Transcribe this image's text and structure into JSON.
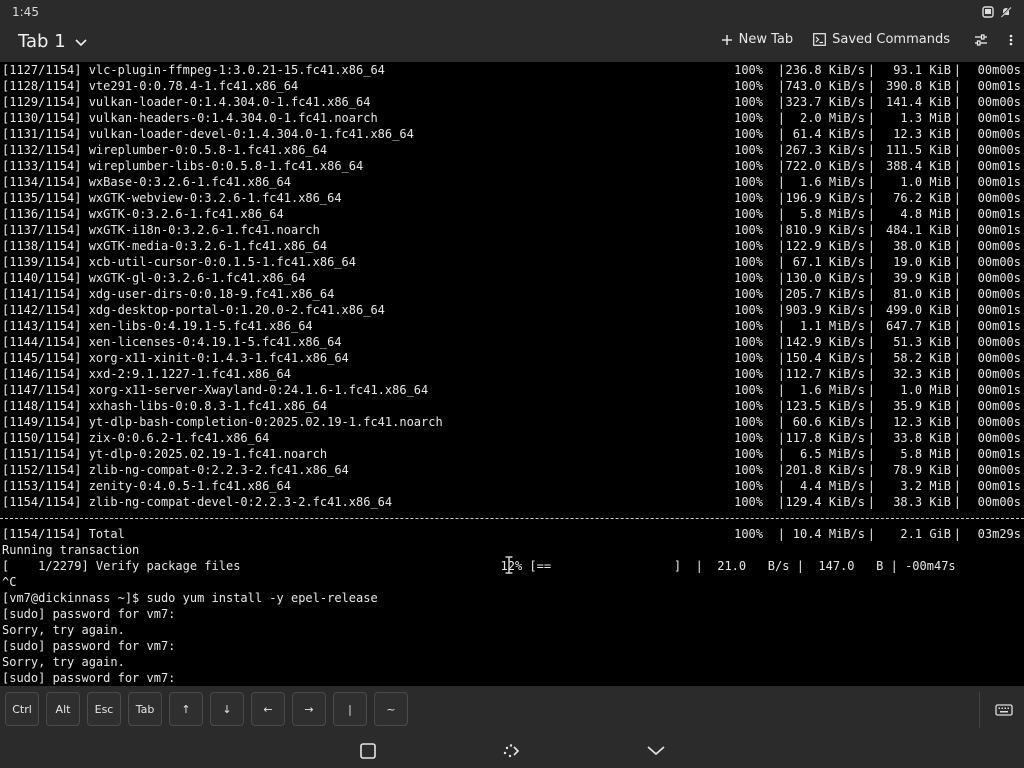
{
  "status_bar": {
    "time": "1:45"
  },
  "app_bar": {
    "tab_title": "Tab 1",
    "new_tab_label": "New Tab",
    "saved_commands_label": "Saved Commands"
  },
  "terminal": {
    "package_lines": [
      {
        "label": "[1127/1154] vlc-plugin-ffmpeg-1:3.0.21-15.fc41.x86_64",
        "pct": "100%",
        "speed": "236.8 KiB/s",
        "size": "93.1 KiB",
        "time": "00m00s"
      },
      {
        "label": "[1128/1154] vte291-0:0.78.4-1.fc41.x86_64",
        "pct": "100%",
        "speed": "743.0 KiB/s",
        "size": "390.8 KiB",
        "time": "00m01s"
      },
      {
        "label": "[1129/1154] vulkan-loader-0:1.4.304.0-1.fc41.x86_64",
        "pct": "100%",
        "speed": "323.7 KiB/s",
        "size": "141.4 KiB",
        "time": "00m00s"
      },
      {
        "label": "[1130/1154] vulkan-headers-0:1.4.304.0-1.fc41.noarch",
        "pct": "100%",
        "speed": "2.0 MiB/s",
        "size": "1.3 MiB",
        "time": "00m01s"
      },
      {
        "label": "[1131/1154] vulkan-loader-devel-0:1.4.304.0-1.fc41.x86_64",
        "pct": "100%",
        "speed": "61.4 KiB/s",
        "size": "12.3 KiB",
        "time": "00m00s"
      },
      {
        "label": "[1132/1154] wireplumber-0:0.5.8-1.fc41.x86_64",
        "pct": "100%",
        "speed": "267.3 KiB/s",
        "size": "111.5 KiB",
        "time": "00m00s"
      },
      {
        "label": "[1133/1154] wireplumber-libs-0:0.5.8-1.fc41.x86_64",
        "pct": "100%",
        "speed": "722.0 KiB/s",
        "size": "388.4 KiB",
        "time": "00m01s"
      },
      {
        "label": "[1134/1154] wxBase-0:3.2.6-1.fc41.x86_64",
        "pct": "100%",
        "speed": "1.6 MiB/s",
        "size": "1.0 MiB",
        "time": "00m01s"
      },
      {
        "label": "[1135/1154] wxGTK-webview-0:3.2.6-1.fc41.x86_64",
        "pct": "100%",
        "speed": "196.9 KiB/s",
        "size": "76.2 KiB",
        "time": "00m00s"
      },
      {
        "label": "[1136/1154] wxGTK-0:3.2.6-1.fc41.x86_64",
        "pct": "100%",
        "speed": "5.8 MiB/s",
        "size": "4.8 MiB",
        "time": "00m01s"
      },
      {
        "label": "[1137/1154] wxGTK-i18n-0:3.2.6-1.fc41.noarch",
        "pct": "100%",
        "speed": "810.9 KiB/s",
        "size": "484.1 KiB",
        "time": "00m01s"
      },
      {
        "label": "[1138/1154] wxGTK-media-0:3.2.6-1.fc41.x86_64",
        "pct": "100%",
        "speed": "122.9 KiB/s",
        "size": "38.0 KiB",
        "time": "00m00s"
      },
      {
        "label": "[1139/1154] xcb-util-cursor-0:0.1.5-1.fc41.x86_64",
        "pct": "100%",
        "speed": "67.1 KiB/s",
        "size": "19.0 KiB",
        "time": "00m00s"
      },
      {
        "label": "[1140/1154] wxGTK-gl-0:3.2.6-1.fc41.x86_64",
        "pct": "100%",
        "speed": "130.0 KiB/s",
        "size": "39.9 KiB",
        "time": "00m00s"
      },
      {
        "label": "[1141/1154] xdg-user-dirs-0:0.18-9.fc41.x86_64",
        "pct": "100%",
        "speed": "205.7 KiB/s",
        "size": "81.0 KiB",
        "time": "00m00s"
      },
      {
        "label": "[1142/1154] xdg-desktop-portal-0:1.20.0-2.fc41.x86_64",
        "pct": "100%",
        "speed": "903.9 KiB/s",
        "size": "499.0 KiB",
        "time": "00m01s"
      },
      {
        "label": "[1143/1154] xen-libs-0:4.19.1-5.fc41.x86_64",
        "pct": "100%",
        "speed": "1.1 MiB/s",
        "size": "647.7 KiB",
        "time": "00m01s"
      },
      {
        "label": "[1144/1154] xen-licenses-0:4.19.1-5.fc41.x86_64",
        "pct": "100%",
        "speed": "142.9 KiB/s",
        "size": "51.3 KiB",
        "time": "00m00s"
      },
      {
        "label": "[1145/1154] xorg-x11-xinit-0:1.4.3-1.fc41.x86_64",
        "pct": "100%",
        "speed": "150.4 KiB/s",
        "size": "58.2 KiB",
        "time": "00m00s"
      },
      {
        "label": "[1146/1154] xxd-2:9.1.1227-1.fc41.x86_64",
        "pct": "100%",
        "speed": "112.7 KiB/s",
        "size": "32.3 KiB",
        "time": "00m00s"
      },
      {
        "label": "[1147/1154] xorg-x11-server-Xwayland-0:24.1.6-1.fc41.x86_64",
        "pct": "100%",
        "speed": "1.6 MiB/s",
        "size": "1.0 MiB",
        "time": "00m01s"
      },
      {
        "label": "[1148/1154] xxhash-libs-0:0.8.3-1.fc41.x86_64",
        "pct": "100%",
        "speed": "123.5 KiB/s",
        "size": "35.9 KiB",
        "time": "00m00s"
      },
      {
        "label": "[1149/1154] yt-dlp-bash-completion-0:2025.02.19-1.fc41.noarch",
        "pct": "100%",
        "speed": "60.6 KiB/s",
        "size": "12.3 KiB",
        "time": "00m00s"
      },
      {
        "label": "[1150/1154] zix-0:0.6.2-1.fc41.x86_64",
        "pct": "100%",
        "speed": "117.8 KiB/s",
        "size": "33.8 KiB",
        "time": "00m00s"
      },
      {
        "label": "[1151/1154] yt-dlp-0:2025.02.19-1.fc41.noarch",
        "pct": "100%",
        "speed": "6.5 MiB/s",
        "size": "5.8 MiB",
        "time": "00m01s"
      },
      {
        "label": "[1152/1154] zlib-ng-compat-0:2.2.3-2.fc41.x86_64",
        "pct": "100%",
        "speed": "201.8 KiB/s",
        "size": "78.9 KiB",
        "time": "00m00s"
      },
      {
        "label": "[1153/1154] zenity-0:4.0.5-1.fc41.x86_64",
        "pct": "100%",
        "speed": "4.4 MiB/s",
        "size": "3.2 MiB",
        "time": "00m01s"
      },
      {
        "label": "[1154/1154] zlib-ng-compat-devel-0:2.2.3-2.fc41.x86_64",
        "pct": "100%",
        "speed": "129.4 KiB/s",
        "size": "38.3 KiB",
        "time": "00m00s"
      }
    ],
    "total_line": {
      "label": "[1154/1154] Total",
      "pct": "100%",
      "speed": "10.4 MiB/s",
      "size": "2.1 GiB",
      "time": "03m29s"
    },
    "running_transaction": "Running transaction",
    "verify_line": "[    1/2279] Verify package files                                    12% [==                 ]  |  21.0   B/s |  147.0   B | -00m47s",
    "interrupt": "^C",
    "prompt_line": "[vm7@dickinnass ~]$ sudo yum install -y epel-release",
    "output_lines": [
      "[sudo] password for vm7:",
      "Sorry, try again.",
      "[sudo] password for vm7:",
      "Sorry, try again.",
      "[sudo] password for vm7:"
    ]
  },
  "extra_keys": [
    "Ctrl",
    "Alt",
    "Esc",
    "Tab",
    "↑",
    "↓",
    "←",
    "→",
    "|",
    "~"
  ],
  "icons": {
    "status": [
      "notification-icon",
      "dnd-icon"
    ],
    "app_bar": [
      "chevron-down-icon",
      "plus-icon",
      "terminal-icon",
      "sliders-icon",
      "more-vert-icon"
    ],
    "nav": [
      "overview-icon",
      "rotate-icon",
      "hide-keyboard-icon"
    ],
    "keybar": [
      "keyboard-icon"
    ]
  }
}
